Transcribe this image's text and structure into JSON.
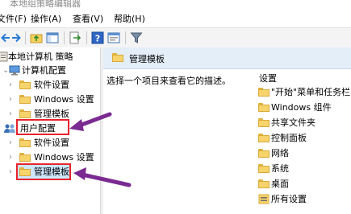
{
  "window": {
    "title": "本地组策略编辑器"
  },
  "menu": [
    "文件(F)",
    "操作(A)",
    "查看(V)",
    "帮助(H)"
  ],
  "tree": {
    "root": "本地计算机 策略",
    "computer_config": "计算机配置",
    "cc_software": "软件设置",
    "cc_windows": "Windows 设置",
    "cc_admin": "管理模板",
    "user_config": "用户配置",
    "uc_software": "软件设置",
    "uc_windows": "Windows 设置",
    "uc_admin": "管理模板"
  },
  "right": {
    "header": "管理模板",
    "description": "选择一个项目来查看它的描述。",
    "column": "设置",
    "items": [
      "\"开始\"菜单和任务栏",
      "Windows 组件",
      "共享文件夹",
      "控制面板",
      "网络",
      "系统",
      "桌面",
      "所有设置"
    ]
  }
}
